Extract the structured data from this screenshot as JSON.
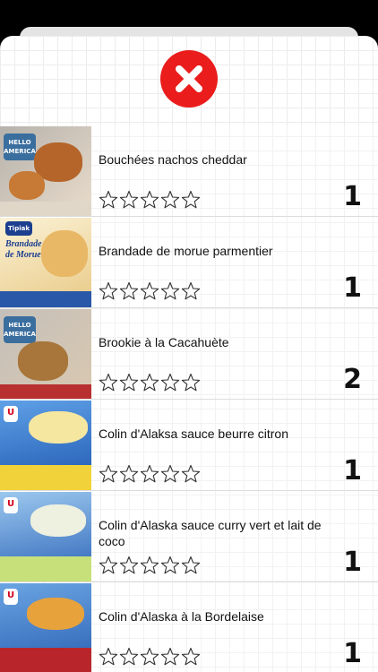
{
  "close_icon": "close-x-icon",
  "accent_color": "#ea1c1c",
  "products": [
    {
      "name": "Bouchées nachos cheddar",
      "rating": 0,
      "count": "1",
      "thumb": "hello-america-nachos"
    },
    {
      "name": "Brandade de morue parmentier",
      "rating": 0,
      "count": "1",
      "thumb": "tipiak-brandade"
    },
    {
      "name": "Brookie à la Cacahuète",
      "rating": 0,
      "count": "2",
      "thumb": "hello-america-brookie"
    },
    {
      "name": "Colin d'Alaksa sauce beurre citron",
      "rating": 0,
      "count": "1",
      "thumb": "u-colin-citron"
    },
    {
      "name": "Colin d'Alaska sauce curry vert et lait de coco",
      "rating": 0,
      "count": "1",
      "thumb": "u-colin-curry"
    },
    {
      "name": "Colin d'Alaska à la Bordelaise",
      "rating": 0,
      "count": "1",
      "thumb": "u-colin-bordelaise"
    }
  ]
}
